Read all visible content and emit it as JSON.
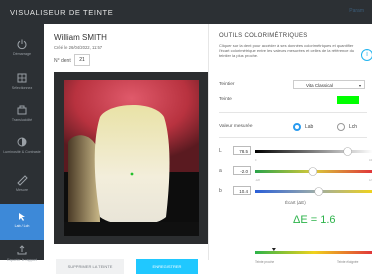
{
  "app": {
    "title": "VISUALISEUR DE TEINTE",
    "settings_label": "Param"
  },
  "sidebar": {
    "items": [
      {
        "label": "Démarrage",
        "icon": "power-icon",
        "active": false
      },
      {
        "label": "Sélectionnez",
        "icon": "grid-icon",
        "active": false
      },
      {
        "label": "Translucidité",
        "icon": "camera-icon",
        "active": false
      },
      {
        "label": "Luminosité & Contraste",
        "icon": "contrast-icon",
        "active": false
      },
      {
        "label": "Mesure",
        "icon": "ruler-icon",
        "active": false
      },
      {
        "label": "Lab / Lch",
        "icon": "pointer-icon",
        "active": true
      },
      {
        "label": "Exporter le rapport",
        "icon": "upload-icon",
        "active": false
      }
    ]
  },
  "patient": {
    "name": "William SMITH",
    "created": "Créé le 26/04/2022, 11:57",
    "tooth_label": "N° dent",
    "tooth_number": "21"
  },
  "actions": {
    "delete": "SUPPRIMER LA TEINTE",
    "save": "ENREGISTRER"
  },
  "panel": {
    "title": "OUTILS COLORIMÉTRIQUES",
    "description": "Cliquer sur la dent pour accéder à ses données colorimétriques et quantifier l'écart colorimétrique entre les valeurs mesurées et celles de la référence du teintier la plus proche.",
    "shade_guide_label": "Teintier",
    "shade_guide_value": "Vita Classical",
    "shade_label": "Teinte",
    "shade_color": "#00ff00",
    "measured_label": "Valeur mesurée",
    "mode_lab": "Lab",
    "mode_lch": "Lch",
    "selected_mode": "Lab",
    "values": [
      {
        "letter": "L",
        "value": "78.5",
        "min": "0",
        "max": "100",
        "position": 0.785
      },
      {
        "letter": "a",
        "value": "-2.0",
        "min": "-128",
        "max": "127",
        "position": 0.49
      },
      {
        "letter": "b",
        "value": "10.4",
        "min": "-128",
        "max": "127",
        "position": 0.54
      }
    ],
    "delta_label": "Écart (ΔE)",
    "delta_value": "ΔE = 1.6",
    "delta_position": 0.16,
    "scale_min_label": "Teinte proche",
    "scale_max_label": "Teinte éloignée"
  }
}
